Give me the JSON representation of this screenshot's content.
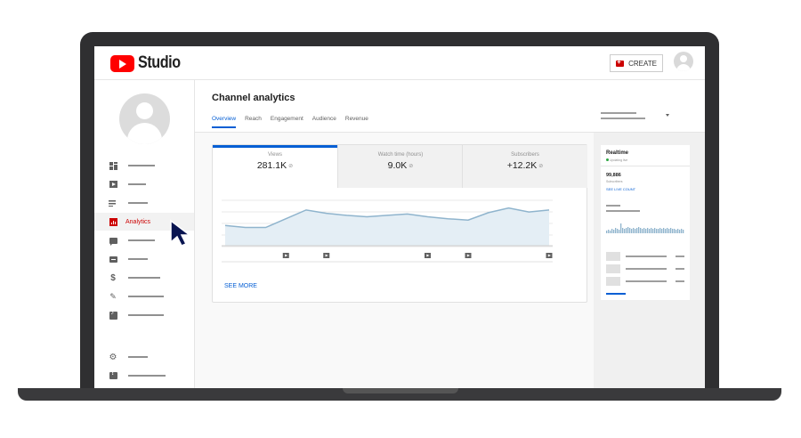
{
  "header": {
    "logo_text": "Studio",
    "create_label": "CREATE"
  },
  "sidebar": {
    "active_label": "Analytics"
  },
  "main": {
    "title": "Channel analytics",
    "tabs": [
      {
        "label": "Overview",
        "active": true
      },
      {
        "label": "Reach",
        "active": false
      },
      {
        "label": "Engagement",
        "active": false
      },
      {
        "label": "Audience",
        "active": false
      },
      {
        "label": "Revenue",
        "active": false
      }
    ],
    "metrics": [
      {
        "label": "Views",
        "value": "281.1K"
      },
      {
        "label": "Watch time (hours)",
        "value": "9.0K"
      },
      {
        "label": "Subscribers",
        "value": "+12.2K"
      }
    ],
    "see_more": "SEE MORE"
  },
  "realtime": {
    "title": "Realtime",
    "updating": "Updating live",
    "subscriber_count": "99,886",
    "subscriber_label": "Subscribers",
    "live_count_link": "SEE LIVE COUNT"
  },
  "colors": {
    "brand_red": "#ff0000",
    "accent_blue": "#065fd4",
    "active_nav_red": "#cc0000",
    "chart_line": "#8fb4cd",
    "chart_fill": "#e4eef5"
  },
  "chart_data": {
    "type": "area",
    "title": "",
    "xlabel": "",
    "ylabel": "",
    "values": [
      30,
      27,
      27,
      40,
      53,
      48,
      45,
      43,
      45,
      47,
      43,
      40,
      38,
      49,
      56,
      50,
      53
    ],
    "ylim": [
      0,
      70
    ],
    "grid": true,
    "video_markers": [
      3,
      5,
      10,
      12,
      16
    ]
  }
}
